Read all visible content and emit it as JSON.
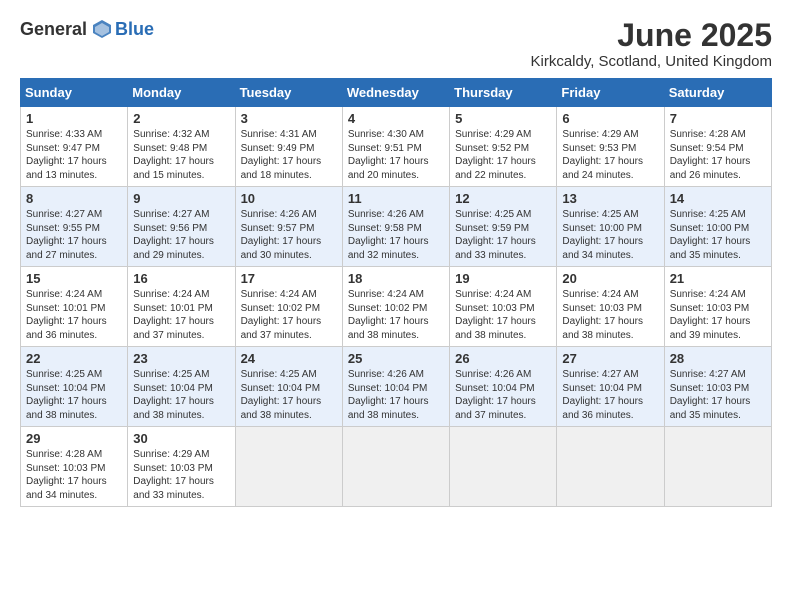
{
  "logo": {
    "general": "General",
    "blue": "Blue"
  },
  "title": "June 2025",
  "subtitle": "Kirkcaldy, Scotland, United Kingdom",
  "days": [
    "Sunday",
    "Monday",
    "Tuesday",
    "Wednesday",
    "Thursday",
    "Friday",
    "Saturday"
  ],
  "weeks": [
    [
      {
        "num": "1",
        "sunrise": "Sunrise: 4:33 AM",
        "sunset": "Sunset: 9:47 PM",
        "daylight": "Daylight: 17 hours and 13 minutes."
      },
      {
        "num": "2",
        "sunrise": "Sunrise: 4:32 AM",
        "sunset": "Sunset: 9:48 PM",
        "daylight": "Daylight: 17 hours and 15 minutes."
      },
      {
        "num": "3",
        "sunrise": "Sunrise: 4:31 AM",
        "sunset": "Sunset: 9:49 PM",
        "daylight": "Daylight: 17 hours and 18 minutes."
      },
      {
        "num": "4",
        "sunrise": "Sunrise: 4:30 AM",
        "sunset": "Sunset: 9:51 PM",
        "daylight": "Daylight: 17 hours and 20 minutes."
      },
      {
        "num": "5",
        "sunrise": "Sunrise: 4:29 AM",
        "sunset": "Sunset: 9:52 PM",
        "daylight": "Daylight: 17 hours and 22 minutes."
      },
      {
        "num": "6",
        "sunrise": "Sunrise: 4:29 AM",
        "sunset": "Sunset: 9:53 PM",
        "daylight": "Daylight: 17 hours and 24 minutes."
      },
      {
        "num": "7",
        "sunrise": "Sunrise: 4:28 AM",
        "sunset": "Sunset: 9:54 PM",
        "daylight": "Daylight: 17 hours and 26 minutes."
      }
    ],
    [
      {
        "num": "8",
        "sunrise": "Sunrise: 4:27 AM",
        "sunset": "Sunset: 9:55 PM",
        "daylight": "Daylight: 17 hours and 27 minutes."
      },
      {
        "num": "9",
        "sunrise": "Sunrise: 4:27 AM",
        "sunset": "Sunset: 9:56 PM",
        "daylight": "Daylight: 17 hours and 29 minutes."
      },
      {
        "num": "10",
        "sunrise": "Sunrise: 4:26 AM",
        "sunset": "Sunset: 9:57 PM",
        "daylight": "Daylight: 17 hours and 30 minutes."
      },
      {
        "num": "11",
        "sunrise": "Sunrise: 4:26 AM",
        "sunset": "Sunset: 9:58 PM",
        "daylight": "Daylight: 17 hours and 32 minutes."
      },
      {
        "num": "12",
        "sunrise": "Sunrise: 4:25 AM",
        "sunset": "Sunset: 9:59 PM",
        "daylight": "Daylight: 17 hours and 33 minutes."
      },
      {
        "num": "13",
        "sunrise": "Sunrise: 4:25 AM",
        "sunset": "Sunset: 10:00 PM",
        "daylight": "Daylight: 17 hours and 34 minutes."
      },
      {
        "num": "14",
        "sunrise": "Sunrise: 4:25 AM",
        "sunset": "Sunset: 10:00 PM",
        "daylight": "Daylight: 17 hours and 35 minutes."
      }
    ],
    [
      {
        "num": "15",
        "sunrise": "Sunrise: 4:24 AM",
        "sunset": "Sunset: 10:01 PM",
        "daylight": "Daylight: 17 hours and 36 minutes."
      },
      {
        "num": "16",
        "sunrise": "Sunrise: 4:24 AM",
        "sunset": "Sunset: 10:01 PM",
        "daylight": "Daylight: 17 hours and 37 minutes."
      },
      {
        "num": "17",
        "sunrise": "Sunrise: 4:24 AM",
        "sunset": "Sunset: 10:02 PM",
        "daylight": "Daylight: 17 hours and 37 minutes."
      },
      {
        "num": "18",
        "sunrise": "Sunrise: 4:24 AM",
        "sunset": "Sunset: 10:02 PM",
        "daylight": "Daylight: 17 hours and 38 minutes."
      },
      {
        "num": "19",
        "sunrise": "Sunrise: 4:24 AM",
        "sunset": "Sunset: 10:03 PM",
        "daylight": "Daylight: 17 hours and 38 minutes."
      },
      {
        "num": "20",
        "sunrise": "Sunrise: 4:24 AM",
        "sunset": "Sunset: 10:03 PM",
        "daylight": "Daylight: 17 hours and 38 minutes."
      },
      {
        "num": "21",
        "sunrise": "Sunrise: 4:24 AM",
        "sunset": "Sunset: 10:03 PM",
        "daylight": "Daylight: 17 hours and 39 minutes."
      }
    ],
    [
      {
        "num": "22",
        "sunrise": "Sunrise: 4:25 AM",
        "sunset": "Sunset: 10:04 PM",
        "daylight": "Daylight: 17 hours and 38 minutes."
      },
      {
        "num": "23",
        "sunrise": "Sunrise: 4:25 AM",
        "sunset": "Sunset: 10:04 PM",
        "daylight": "Daylight: 17 hours and 38 minutes."
      },
      {
        "num": "24",
        "sunrise": "Sunrise: 4:25 AM",
        "sunset": "Sunset: 10:04 PM",
        "daylight": "Daylight: 17 hours and 38 minutes."
      },
      {
        "num": "25",
        "sunrise": "Sunrise: 4:26 AM",
        "sunset": "Sunset: 10:04 PM",
        "daylight": "Daylight: 17 hours and 38 minutes."
      },
      {
        "num": "26",
        "sunrise": "Sunrise: 4:26 AM",
        "sunset": "Sunset: 10:04 PM",
        "daylight": "Daylight: 17 hours and 37 minutes."
      },
      {
        "num": "27",
        "sunrise": "Sunrise: 4:27 AM",
        "sunset": "Sunset: 10:04 PM",
        "daylight": "Daylight: 17 hours and 36 minutes."
      },
      {
        "num": "28",
        "sunrise": "Sunrise: 4:27 AM",
        "sunset": "Sunset: 10:03 PM",
        "daylight": "Daylight: 17 hours and 35 minutes."
      }
    ],
    [
      {
        "num": "29",
        "sunrise": "Sunrise: 4:28 AM",
        "sunset": "Sunset: 10:03 PM",
        "daylight": "Daylight: 17 hours and 34 minutes."
      },
      {
        "num": "30",
        "sunrise": "Sunrise: 4:29 AM",
        "sunset": "Sunset: 10:03 PM",
        "daylight": "Daylight: 17 hours and 33 minutes."
      },
      null,
      null,
      null,
      null,
      null
    ]
  ]
}
